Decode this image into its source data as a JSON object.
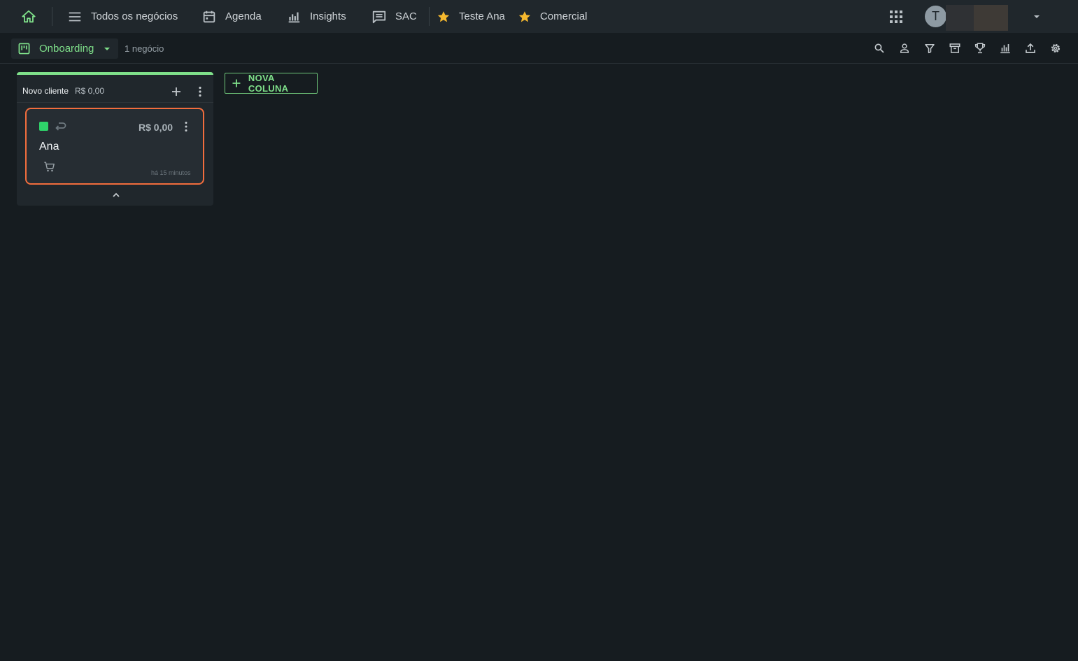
{
  "nav": {
    "items": [
      {
        "label": "Todos os negócios",
        "icon": "menu-icon"
      },
      {
        "label": "Agenda",
        "icon": "calendar-icon"
      },
      {
        "label": "Insights",
        "icon": "bar-chart-icon"
      },
      {
        "label": "SAC",
        "icon": "message-icon"
      }
    ],
    "favorites": [
      {
        "label": "Teste Ana",
        "icon": "star-icon"
      },
      {
        "label": "Comercial",
        "icon": "star-icon"
      }
    ],
    "user_initial": "T"
  },
  "toolbar": {
    "pipeline_label": "Onboarding",
    "deal_count": "1 negócio",
    "icons": [
      "search-icon",
      "person-icon",
      "filter-icon",
      "archive-icon",
      "trophy-icon",
      "chart-icon",
      "upload-icon",
      "settings-icon"
    ]
  },
  "board": {
    "columns": [
      {
        "title": "Novo cliente",
        "total": "R$ 0,00",
        "cards": [
          {
            "value": "R$ 0,00",
            "name": "Ana",
            "time": "há 15 minutos"
          }
        ]
      }
    ],
    "new_column_label": "NOVA COLUNA"
  },
  "colors": {
    "accent_green": "#7fe08a",
    "status_green": "#2fd36a",
    "card_highlight": "#f26d3d",
    "star": "#f5b82e",
    "background": "#161c20"
  }
}
